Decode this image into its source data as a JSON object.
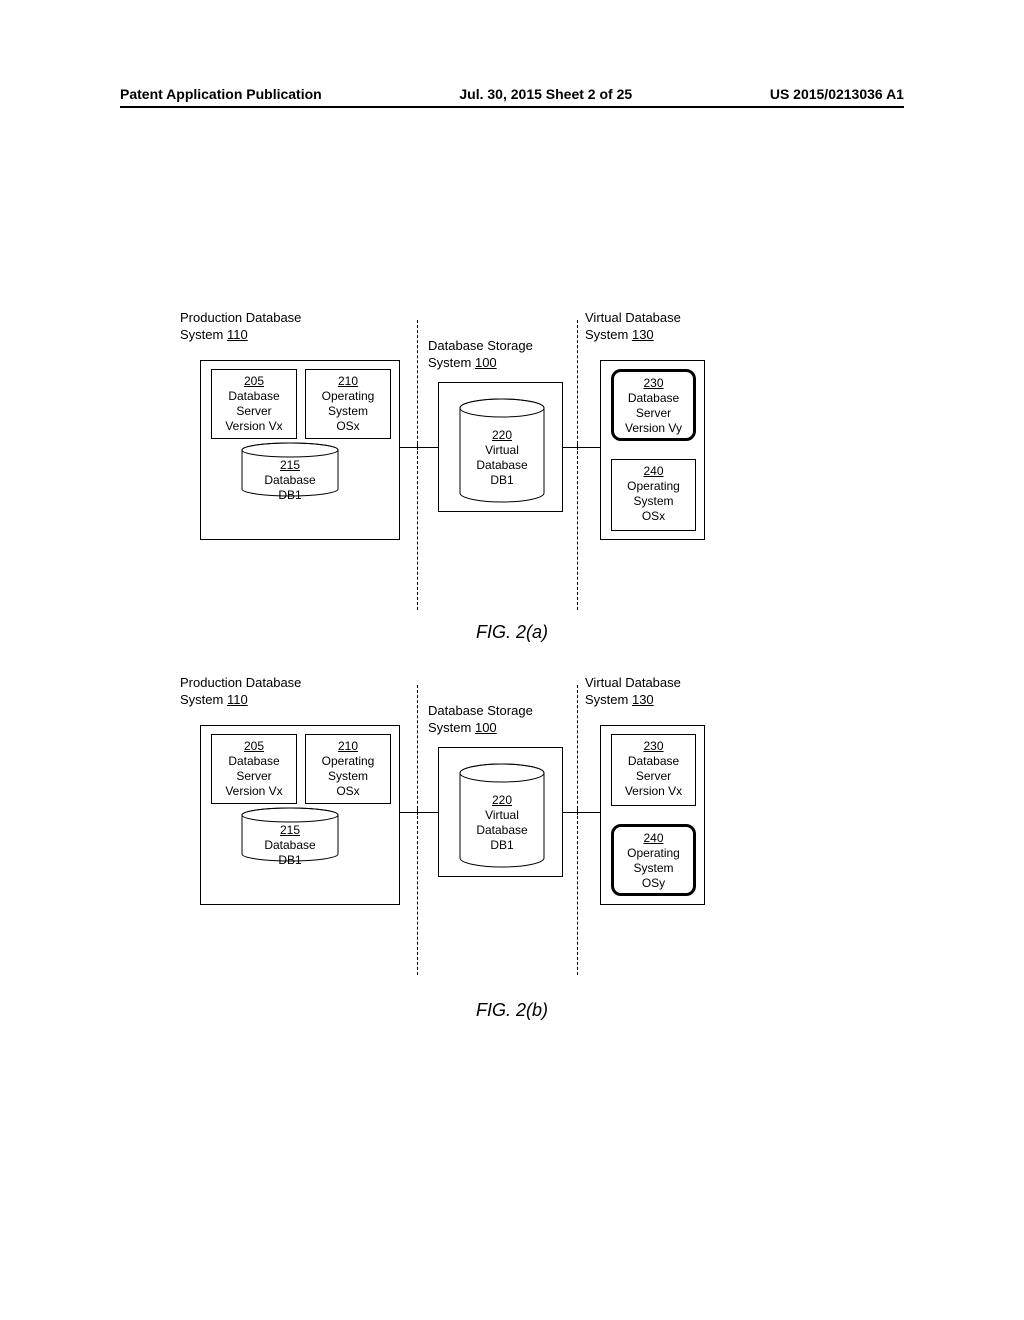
{
  "header": {
    "left": "Patent Application Publication",
    "center": "Jul. 30, 2015  Sheet 2 of 25",
    "right": "US 2015/0213036 A1"
  },
  "fig_a": {
    "caption": "FIG. 2(a)",
    "prod": {
      "label_prefix": "Production Database System ",
      "label_num": "110",
      "b205": {
        "num": "205",
        "l1": "Database",
        "l2": "Server",
        "l3": "Version Vx"
      },
      "b210": {
        "num": "210",
        "l1": "Operating",
        "l2": "System",
        "l3": "OSx"
      },
      "b215": {
        "num": "215",
        "l1": "Database",
        "l2": "DB1"
      }
    },
    "store": {
      "label_prefix": "Database Storage System ",
      "label_num": "100",
      "b220": {
        "num": "220",
        "l1": "Virtual",
        "l2": "Database",
        "l3": "DB1"
      }
    },
    "virt": {
      "label_prefix": "Virtual Database System ",
      "label_num": "130",
      "b230": {
        "num": "230",
        "l1": "Database",
        "l2": "Server",
        "l3": "Version Vy",
        "highlight": true
      },
      "b240": {
        "num": "240",
        "l1": "Operating",
        "l2": "System",
        "l3": "OSx",
        "highlight": false
      }
    }
  },
  "fig_b": {
    "caption": "FIG. 2(b)",
    "prod": {
      "label_prefix": "Production Database System ",
      "label_num": "110",
      "b205": {
        "num": "205",
        "l1": "Database",
        "l2": "Server",
        "l3": "Version Vx"
      },
      "b210": {
        "num": "210",
        "l1": "Operating",
        "l2": "System",
        "l3": "OSx"
      },
      "b215": {
        "num": "215",
        "l1": "Database",
        "l2": "DB1"
      }
    },
    "store": {
      "label_prefix": "Database Storage System ",
      "label_num": "100",
      "b220": {
        "num": "220",
        "l1": "Virtual",
        "l2": "Database",
        "l3": "DB1"
      }
    },
    "virt": {
      "label_prefix": "Virtual Database System ",
      "label_num": "130",
      "b230": {
        "num": "230",
        "l1": "Database",
        "l2": "Server",
        "l3": "Version Vx",
        "highlight": false
      },
      "b240": {
        "num": "240",
        "l1": "Operating",
        "l2": "System",
        "l3": "OSy",
        "highlight": true
      }
    }
  }
}
